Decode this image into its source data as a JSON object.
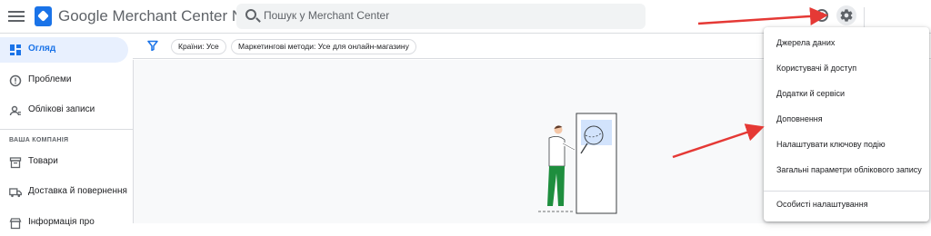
{
  "header": {
    "app_title": "Google Merchant Center Next",
    "search_placeholder": "Пошук у Merchant Center"
  },
  "sidebar": {
    "items": [
      {
        "label": "Огляд",
        "icon": "dashboard-icon",
        "active": true
      },
      {
        "label": "Проблеми",
        "icon": "alert-circle-icon",
        "active": false
      },
      {
        "label": "Облікові записи",
        "icon": "accounts-icon",
        "active": false
      },
      {
        "label": "Товари",
        "icon": "inventory-icon",
        "active": false
      },
      {
        "label": "Доставка й повернення",
        "icon": "truck-icon",
        "active": false
      },
      {
        "label": "Інформація про",
        "icon": "store-icon",
        "active": false
      }
    ],
    "section_label": "ВАША КОМПАНІЯ"
  },
  "filters": {
    "chips": [
      "Країни: Усе",
      "Маркетингові методи: Усе для онлайн-магазину"
    ]
  },
  "settings_menu": {
    "items": [
      "Джерела даних",
      "Користувачі й доступ",
      "Додатки й сервіси",
      "Доповнення",
      "Налаштувати ключову подію",
      "Загальні параметри облікового запису",
      "Особисті налаштування"
    ]
  },
  "colors": {
    "accent": "#1a73e8",
    "annotation_arrow": "#e53935"
  }
}
